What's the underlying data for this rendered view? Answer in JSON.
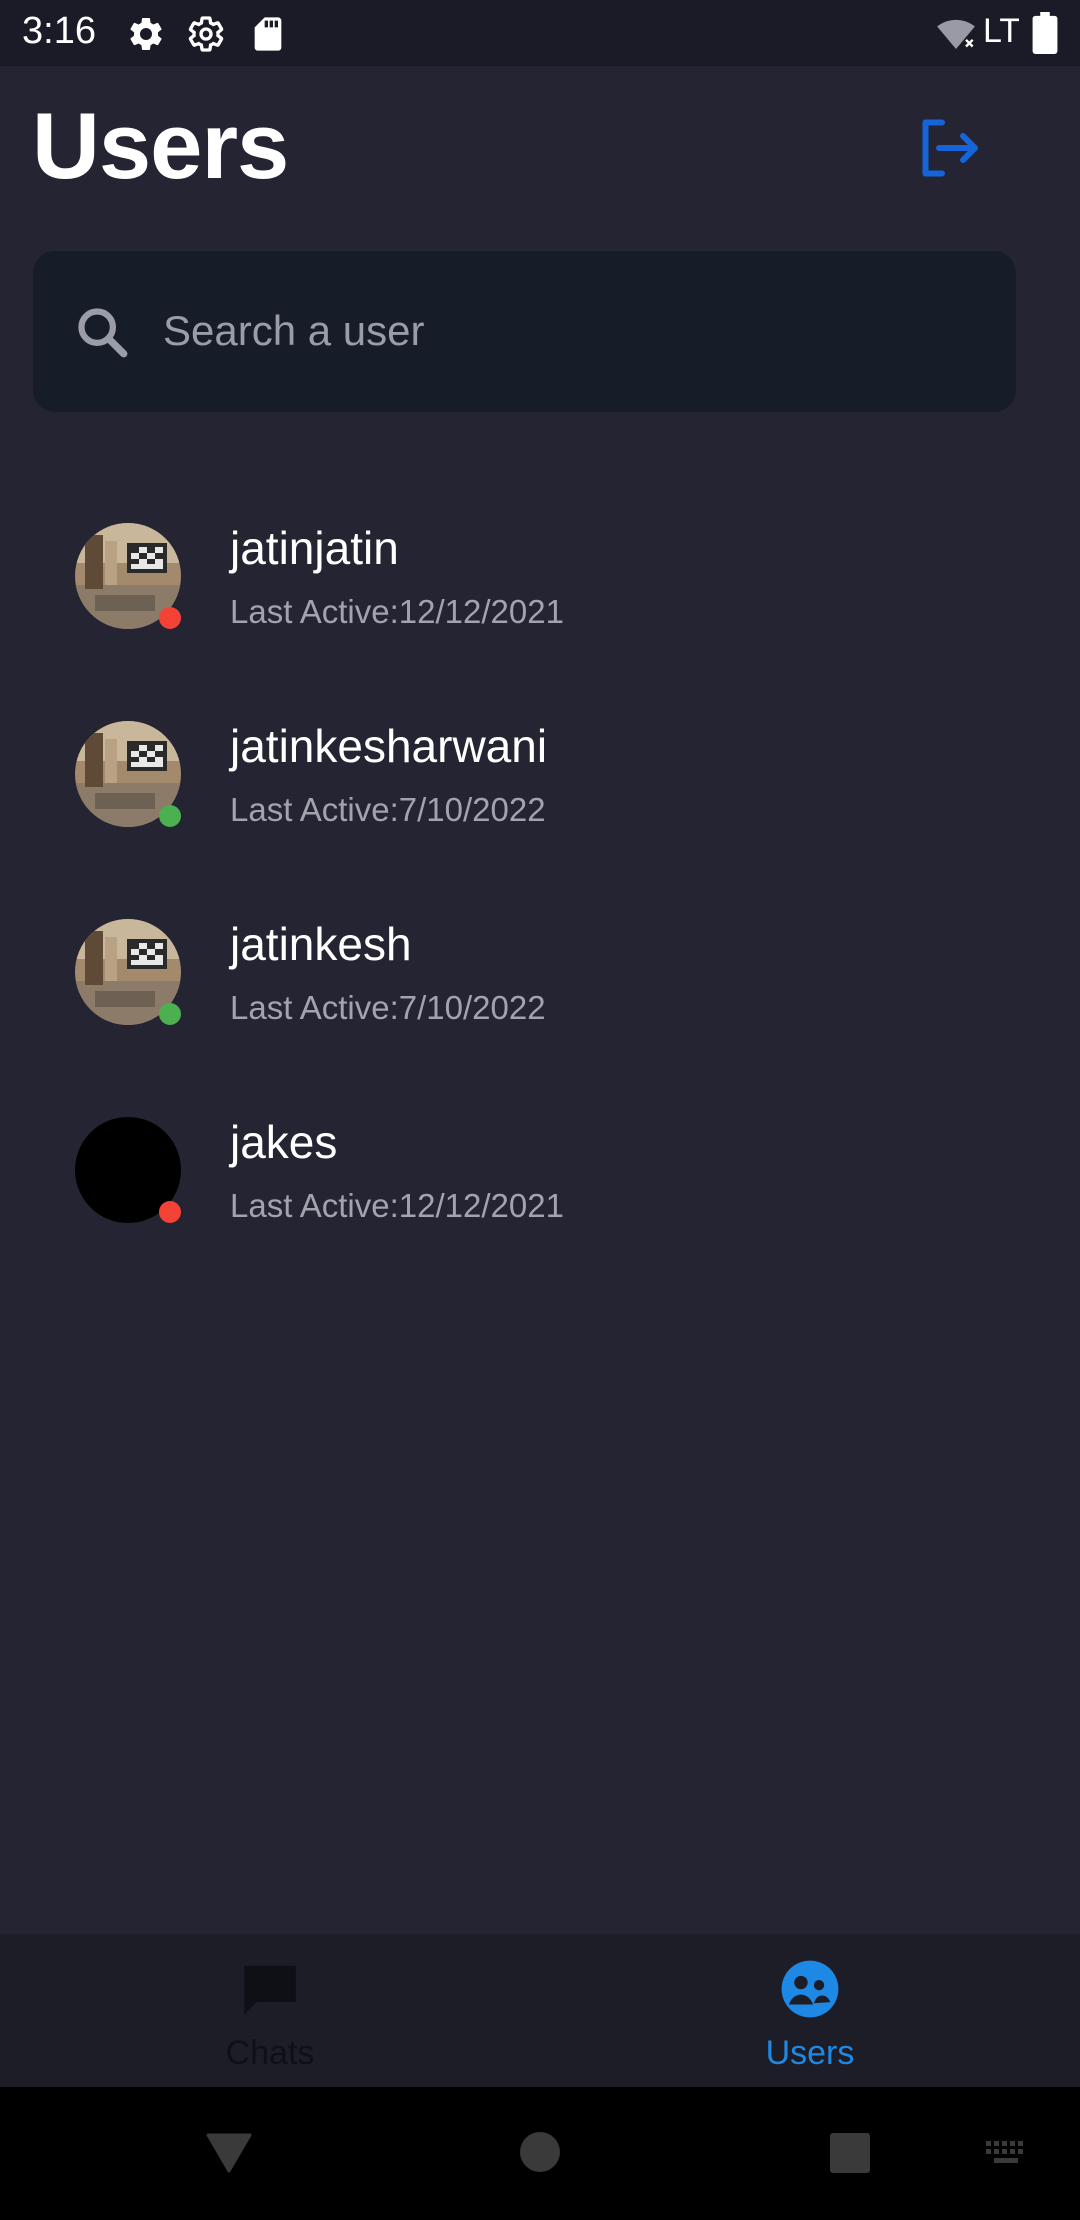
{
  "status_bar": {
    "time": "3:16",
    "icons": [
      "gear-icon",
      "gear-icon",
      "sd-card-icon",
      "wifi-off-icon",
      "battery-icon"
    ],
    "network": "LTE"
  },
  "header": {
    "title": "Users",
    "logout_icon": "logout-icon"
  },
  "search": {
    "placeholder": "Search a user",
    "value": ""
  },
  "users": [
    {
      "name": "jatinjatin",
      "last_active": "Last Active:12/12/2021",
      "online": false,
      "avatar": "photo"
    },
    {
      "name": "jatinkesharwani",
      "last_active": "Last Active:7/10/2022",
      "online": true,
      "avatar": "photo"
    },
    {
      "name": "jatinkesh",
      "last_active": "Last Active:7/10/2022",
      "online": true,
      "avatar": "photo"
    },
    {
      "name": "jakes",
      "last_active": "Last Active:12/12/2021",
      "online": false,
      "avatar": "black"
    }
  ],
  "bottom_nav": {
    "items": [
      {
        "label": "Chats",
        "icon": "chat-bubble-icon",
        "active": false
      },
      {
        "label": "Users",
        "icon": "users-icon",
        "active": true
      }
    ]
  },
  "colors": {
    "background": "#242433",
    "accent": "#1e88e5",
    "logout": "#1565d8",
    "online": "#4caf50",
    "offline": "#f44336",
    "inactive_nav": "#0f0f16"
  }
}
